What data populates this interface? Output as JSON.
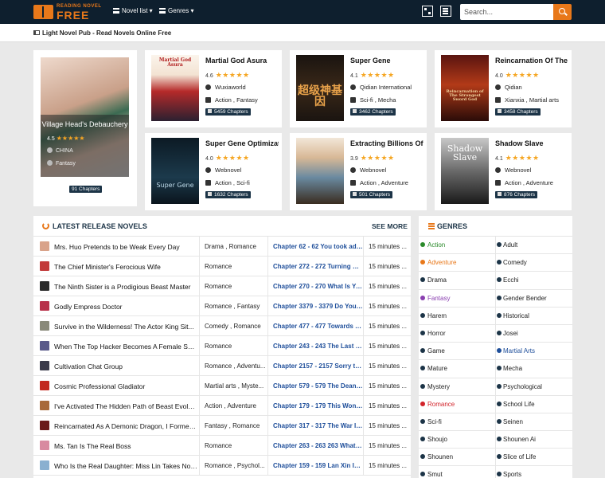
{
  "header": {
    "logo_small": "READING NOVEL",
    "logo_big": "FREE",
    "nav_novel_list": "Novel list",
    "nav_genres": "Genres",
    "search_placeholder": "Search..."
  },
  "subheader": {
    "text": "Light Novel Pub - Read Novels Online Free"
  },
  "featured_big": {
    "title": "Village Head's Debauchery",
    "rating": "4.5",
    "country": "CHINA",
    "genre": "Fantasy",
    "chapters": "91 Chapters"
  },
  "featured": [
    {
      "title": "Martial God Asura",
      "rating": "4.6",
      "source": "Wuxiaworld",
      "genres": "Action , Fantasy",
      "chapters": "5459 Chapters",
      "cover_text": "Martial God Asura"
    },
    {
      "title": "Super Gene",
      "rating": "4.1",
      "source": "Qidian International",
      "genres": "Sci-fi , Mecha",
      "chapters": "3462 Chapters",
      "cover_text": "超级神基因"
    },
    {
      "title": "Reincarnation Of The ...",
      "rating": "4.0",
      "source": "Qidian",
      "genres": "Xianxia , Martial arts",
      "chapters": "3458 Chapters",
      "cover_text": "Reincarnation of The Strongest Sword God"
    },
    {
      "title": "Super Gene Optimizat...",
      "rating": "4.0",
      "source": "Webnovel",
      "genres": "Action , Sci-fi",
      "chapters": "1632 Chapters",
      "cover_text": "Super Gene"
    },
    {
      "title": "Extracting Billions Of ...",
      "rating": "3.9",
      "source": "Webnovel",
      "genres": "Action , Adventure",
      "chapters": "501 Chapters",
      "cover_text": ""
    },
    {
      "title": "Shadow Slave",
      "rating": "4.1",
      "source": "Webnovel",
      "genres": "Action , Adventure",
      "chapters": "876 Chapters",
      "cover_text": "Shadow Slave"
    }
  ],
  "latest": {
    "title": "LATEST RELEASE NOVELS",
    "see_more": "SEE MORE",
    "rows": [
      {
        "name": "Mrs. Huo Pretends to be Weak Every Day",
        "genres": "Drama , Romance",
        "chapter": "Chapter 62 - 62 You took adv...",
        "time": "15 minutes ..."
      },
      {
        "name": "The Chief Minister's Ferocious Wife",
        "genres": "Romance",
        "chapter": "Chapter 272 - 272 Turning Ba...",
        "time": "15 minutes ..."
      },
      {
        "name": "The Ninth Sister is a Prodigious Beast Master",
        "genres": "Romance",
        "chapter": "Chapter 270 - 270 What Is Ya...",
        "time": "15 minutes ..."
      },
      {
        "name": "Godly Empress Doctor",
        "genres": "Romance , Fantasy",
        "chapter": "Chapter 3379 - 3379 Do You A...",
        "time": "15 minutes ..."
      },
      {
        "name": "Survive in the Wilderness! The Actor King Sit...",
        "genres": "Comedy , Romance",
        "chapter": "Chapter 477 - 477 Towards th...",
        "time": "15 minutes ..."
      },
      {
        "name": "When The Top Hacker Becomes A Female Sup...",
        "genres": "Romance",
        "chapter": "Chapter 243 - 243 The Last B...",
        "time": "15 minutes ..."
      },
      {
        "name": "Cultivation Chat Group",
        "genres": "Romance , Adventu...",
        "chapter": "Chapter 2157 - 2157 Sorry to ...",
        "time": "15 minutes ..."
      },
      {
        "name": "Cosmic Professional Gladiator",
        "genres": "Martial arts , Myste...",
        "chapter": "Chapter 579 - 579 The Dean's ...",
        "time": "15 minutes ..."
      },
      {
        "name": "I've Activated The Hidden Path of Beast Evolu...",
        "genres": "Action , Adventure",
        "chapter": "Chapter 179 - 179 This Won't ...",
        "time": "15 minutes ..."
      },
      {
        "name": "Reincarnated As A Demonic Dragon, I Formed...",
        "genres": "Fantasy , Romance",
        "chapter": "Chapter 317 - 317 The War Is ...",
        "time": "15 minutes ..."
      },
      {
        "name": "Ms. Tan Is The Real Boss",
        "genres": "Romance",
        "chapter": "Chapter 263 - 263 263 What D...",
        "time": "15 minutes ..."
      },
      {
        "name": "Who Is the Real Daughter: Miss Lin Takes No ...",
        "genres": "Romance , Psychol...",
        "chapter": "Chapter 159 - 159 Lan Xin Is ...",
        "time": "15 minutes ..."
      }
    ]
  },
  "genres": {
    "title": "GENRES",
    "rows": [
      [
        "Action",
        "Adult"
      ],
      [
        "Adventure",
        "Comedy"
      ],
      [
        "Drama",
        "Ecchi"
      ],
      [
        "Fantasy",
        "Gender Bender"
      ],
      [
        "Harem",
        "Historical"
      ],
      [
        "Horror",
        "Josei"
      ],
      [
        "Game",
        "Martial Arts"
      ],
      [
        "Mature",
        "Mecha"
      ],
      [
        "Mystery",
        "Psychological"
      ],
      [
        "Romance",
        "School Life"
      ],
      [
        "Sci-fi",
        "Seinen"
      ],
      [
        "Shoujo",
        "Shounen Ai"
      ],
      [
        "Shounen",
        "Slice of Life"
      ],
      [
        "Smut",
        "Sports"
      ]
    ],
    "colors": {
      "Action": "#2a8a2a",
      "Adventure": "#e8781a",
      "Fantasy": "#8a3fb0",
      "Romance": "#d2232a",
      "Martial Arts": "#1e4e9a",
      "default": "#222222"
    }
  },
  "colors": {
    "header_bg": "#0e1f2e",
    "accent": "#e8781a",
    "link": "#1e4e9a",
    "badge": "#1c3447"
  }
}
